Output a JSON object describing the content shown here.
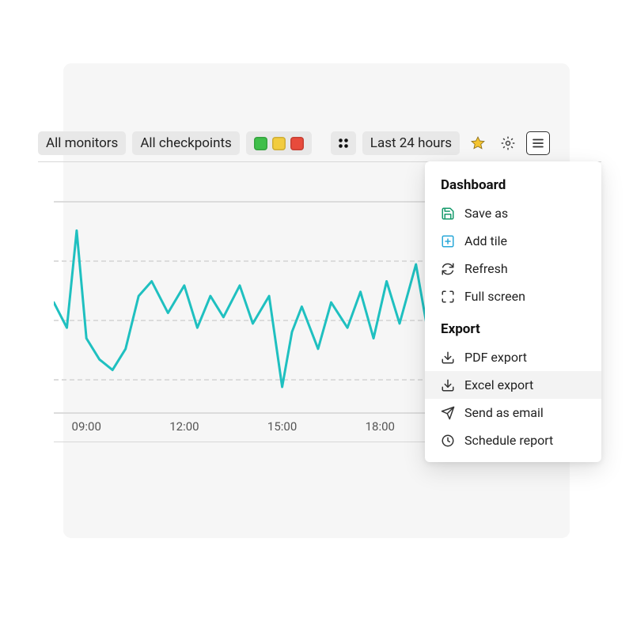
{
  "toolbar": {
    "monitors_label": "All monitors",
    "checkpoints_label": "All checkpoints",
    "timerange_label": "Last 24 hours"
  },
  "dropdown": {
    "section1_title": "Dashboard",
    "save_as": "Save as",
    "add_tile": "Add tile",
    "refresh": "Refresh",
    "full_screen": "Full screen",
    "section2_title": "Export",
    "pdf_export": "PDF export",
    "excel_export": "Excel export",
    "send_email": "Send as email",
    "schedule_report": "Schedule report"
  },
  "colors": {
    "line": "#1fc0c0",
    "status_green": "#3fbf4a",
    "status_yellow": "#f2cc3f",
    "status_red": "#e84b3c",
    "save_icon": "#159a6b",
    "add_icon": "#2aa8d8"
  },
  "chart_data": {
    "type": "line",
    "title": "",
    "xlabel": "",
    "ylabel": "",
    "x_tick_labels": [
      "09:00",
      "12:00",
      "15:00",
      "18:00"
    ],
    "x_tick_positions_hours": [
      9,
      12,
      15,
      18
    ],
    "x_range_hours": [
      8,
      21
    ],
    "ylim": [
      0,
      100
    ],
    "grid_y": [
      0,
      33,
      67,
      100
    ],
    "series": [
      {
        "name": "metric",
        "x_hours": [
          8.0,
          8.4,
          8.7,
          9.0,
          9.4,
          9.8,
          10.2,
          10.6,
          11.0,
          11.5,
          12.0,
          12.4,
          12.8,
          13.2,
          13.7,
          14.1,
          14.6,
          15.0,
          15.3,
          15.6,
          16.1,
          16.5,
          17.0,
          17.4,
          17.8,
          18.2,
          18.6,
          19.1,
          19.5,
          20.0,
          20.4,
          21.0
        ],
        "values": [
          52,
          40,
          86,
          35,
          25,
          20,
          30,
          55,
          62,
          47,
          60,
          40,
          55,
          45,
          60,
          42,
          55,
          12,
          38,
          50,
          30,
          52,
          40,
          57,
          35,
          62,
          42,
          70,
          35,
          60,
          42,
          55
        ]
      }
    ]
  }
}
